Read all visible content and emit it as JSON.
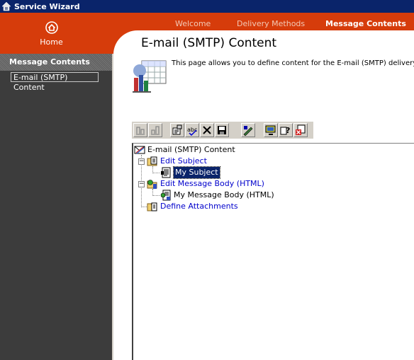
{
  "window": {
    "title": "Service Wizard"
  },
  "home": {
    "label": "Home"
  },
  "nav": {
    "welcome": "Welcome",
    "delivery": "Delivery Methods",
    "message": "Message Contents"
  },
  "sidebar": {
    "header": "Message Contents",
    "item": "E-mail (SMTP) Content"
  },
  "main": {
    "title": "E-mail (SMTP) Content",
    "description": "This page allows you to define content for the E-mail (SMTP) delivery met"
  },
  "toolbar": {
    "buttons": [
      "insert-icon",
      "insert-after-icon",
      "properties-icon",
      "spellcheck-icon",
      "delete-icon",
      "save-icon",
      "edit-icon",
      "preview-icon",
      "help-icon",
      "close-icon"
    ]
  },
  "tree": {
    "root": "E-mail (SMTP) Content",
    "subject": "Edit Subject",
    "subject_child": "My Subject",
    "body": "Edit Message Body (HTML)",
    "body_child": "My Message Body (HTML)",
    "attachments": "Define Attachments"
  },
  "colors": {
    "titlebar": "#0a246a",
    "brand": "#d63c0b",
    "sidebar": "#3c3c3c",
    "link": "#0000cc",
    "selection": "#0a246a"
  }
}
